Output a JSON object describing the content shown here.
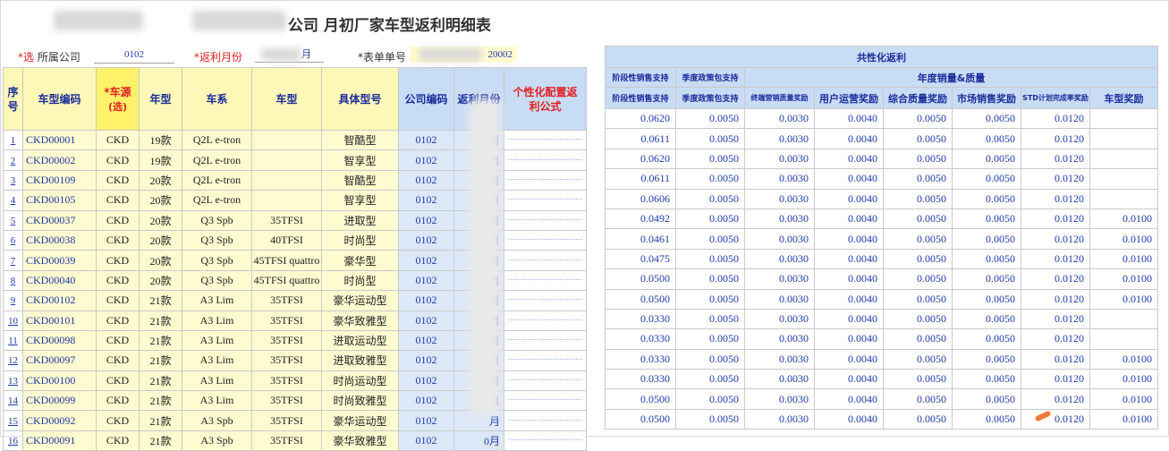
{
  "title": {
    "text": "公司 月初厂家车型返利明细表"
  },
  "meta": {
    "company_required": "*选",
    "company_label": "所属公司",
    "company_value": "0102",
    "month_label": "*返利月份",
    "month_value_suffix": "月",
    "order_label": "*表单单号",
    "order_value_suffix": "20002"
  },
  "left_headers": {
    "seq": "序号",
    "model_code": "车型编码",
    "source_star": "*车源",
    "source_sub": "(选)",
    "year": "年型",
    "series": "车系",
    "model": "车型",
    "spec": "具体型号",
    "company_code": "公司编码",
    "rebate_month": "返利月份",
    "formula": "个性化配置返利公式"
  },
  "right_headers": {
    "group_title": "共性化返利",
    "stage_support": "阶段性销售支持",
    "season_policy": "季度政策包支持",
    "annual_group": "年度销量&质量",
    "sub": [
      "阶段性销售支持",
      "季度政策包支持",
      "终端营销质量奖励",
      "用户运营奖励",
      "综合质量奖励",
      "市场销售奖励",
      "STD计划完成率奖励",
      "车型奖励"
    ]
  },
  "rows": [
    {
      "no": "1",
      "code": "CKD00001",
      "src": "CKD",
      "year": "19款",
      "series": "Q2L e-tron",
      "model": "",
      "spec": "智酷型",
      "co": "0102",
      "month": "月",
      "v": [
        "0.0620",
        "0.0050",
        "0.0030",
        "0.0040",
        "0.0050",
        "0.0050",
        "0.0120",
        ""
      ]
    },
    {
      "no": "2",
      "code": "CKD00002",
      "src": "CKD",
      "year": "19款",
      "series": "Q2L e-tron",
      "model": "",
      "spec": "智享型",
      "co": "0102",
      "month": "0月",
      "v": [
        "0.0611",
        "0.0050",
        "0.0030",
        "0.0040",
        "0.0050",
        "0.0050",
        "0.0120",
        ""
      ]
    },
    {
      "no": "3",
      "code": "CKD00109",
      "src": "CKD",
      "year": "20款",
      "series": "Q2L e-tron",
      "model": "",
      "spec": "智酷型",
      "co": "0102",
      "month": "月",
      "v": [
        "0.0620",
        "0.0050",
        "0.0030",
        "0.0040",
        "0.0050",
        "0.0050",
        "0.0120",
        ""
      ]
    },
    {
      "no": "4",
      "code": "CKD00105",
      "src": "CKD",
      "year": "20款",
      "series": "Q2L e-tron",
      "model": "",
      "spec": "智享型",
      "co": "0102",
      "month": "月",
      "v": [
        "0.0611",
        "0.0050",
        "0.0030",
        "0.0040",
        "0.0050",
        "0.0050",
        "0.0120",
        ""
      ]
    },
    {
      "no": "5",
      "code": "CKD00037",
      "src": "CKD",
      "year": "20款",
      "series": "Q3 Spb",
      "model": "35TFSI",
      "spec": "进取型",
      "co": "0102",
      "month": "月",
      "v": [
        "0.0606",
        "0.0050",
        "0.0030",
        "0.0040",
        "0.0050",
        "0.0050",
        "0.0120",
        ""
      ]
    },
    {
      "no": "6",
      "code": "CKD00038",
      "src": "CKD",
      "year": "20款",
      "series": "Q3 Spb",
      "model": "40TFSI",
      "spec": "时尚型",
      "co": "0102",
      "month": "月",
      "v": [
        "0.0492",
        "0.0050",
        "0.0030",
        "0.0040",
        "0.0050",
        "0.0050",
        "0.0120",
        "0.0100"
      ]
    },
    {
      "no": "7",
      "code": "CKD00039",
      "src": "CKD",
      "year": "20款",
      "series": "Q3 Spb",
      "model": "45TFSI quattro",
      "spec": "豪华型",
      "co": "0102",
      "month": "月",
      "v": [
        "0.0461",
        "0.0050",
        "0.0030",
        "0.0040",
        "0.0050",
        "0.0050",
        "0.0120",
        "0.0100"
      ]
    },
    {
      "no": "8",
      "code": "CKD00040",
      "src": "CKD",
      "year": "20款",
      "series": "Q3 Spb",
      "model": "45TFSI quattro",
      "spec": "时尚型",
      "co": "0102",
      "month": "月",
      "v": [
        "0.0475",
        "0.0050",
        "0.0030",
        "0.0040",
        "0.0050",
        "0.0050",
        "0.0120",
        "0.0100"
      ]
    },
    {
      "no": "9",
      "code": "CKD00102",
      "src": "CKD",
      "year": "21款",
      "series": "A3 Lim",
      "model": "35TFSI",
      "spec": "豪华运动型",
      "co": "0102",
      "month": "月",
      "v": [
        "0.0500",
        "0.0050",
        "0.0030",
        "0.0040",
        "0.0050",
        "0.0050",
        "0.0120",
        "0.0100"
      ]
    },
    {
      "no": "10",
      "code": "CKD00101",
      "src": "CKD",
      "year": "21款",
      "series": "A3 Lim",
      "model": "35TFSI",
      "spec": "豪华致雅型",
      "co": "0102",
      "month": "月",
      "v": [
        "0.0500",
        "0.0050",
        "0.0030",
        "0.0040",
        "0.0050",
        "0.0050",
        "0.0120",
        "0.0100"
      ]
    },
    {
      "no": "11",
      "code": "CKD00098",
      "src": "CKD",
      "year": "21款",
      "series": "A3 Lim",
      "model": "35TFSI",
      "spec": "进取运动型",
      "co": "0102",
      "month": "月",
      "v": [
        "0.0330",
        "0.0050",
        "0.0030",
        "0.0040",
        "0.0050",
        "0.0050",
        "0.0120",
        ""
      ]
    },
    {
      "no": "12",
      "code": "CKD00097",
      "src": "CKD",
      "year": "21款",
      "series": "A3 Lim",
      "model": "35TFSI",
      "spec": "进取致雅型",
      "co": "0102",
      "month": "0月",
      "v": [
        "0.0330",
        "0.0050",
        "0.0030",
        "0.0040",
        "0.0050",
        "0.0050",
        "0.0120",
        ""
      ]
    },
    {
      "no": "13",
      "code": "CKD00100",
      "src": "CKD",
      "year": "21款",
      "series": "A3 Lim",
      "model": "35TFSI",
      "spec": "时尚运动型",
      "co": "0102",
      "month": "0月",
      "v": [
        "0.0330",
        "0.0050",
        "0.0030",
        "0.0040",
        "0.0050",
        "0.0050",
        "0.0120",
        "0.0100"
      ]
    },
    {
      "no": "14",
      "code": "CKD00099",
      "src": "CKD",
      "year": "21款",
      "series": "A3 Lim",
      "model": "35TFSI",
      "spec": "时尚致雅型",
      "co": "0102",
      "month": "月",
      "v": [
        "0.0330",
        "0.0050",
        "0.0030",
        "0.0040",
        "0.0050",
        "0.0050",
        "0.0120",
        "0.0100"
      ]
    },
    {
      "no": "15",
      "code": "CKD00092",
      "src": "CKD",
      "year": "21款",
      "series": "A3 Spb",
      "model": "35TFSI",
      "spec": "豪华运动型",
      "co": "0102",
      "month": "月",
      "v": [
        "0.0500",
        "0.0050",
        "0.0030",
        "0.0040",
        "0.0050",
        "0.0050",
        "0.0120",
        "0.0100"
      ]
    },
    {
      "no": "16",
      "code": "CKD00091",
      "src": "CKD",
      "year": "21款",
      "series": "A3 Spb",
      "model": "35TFSI",
      "spec": "豪华致雅型",
      "co": "0102",
      "month": "0月",
      "v": [
        "0.0500",
        "0.0050",
        "0.0030",
        "0.0040",
        "0.0050",
        "0.0050",
        "0.0120",
        "0.0100"
      ]
    }
  ]
}
